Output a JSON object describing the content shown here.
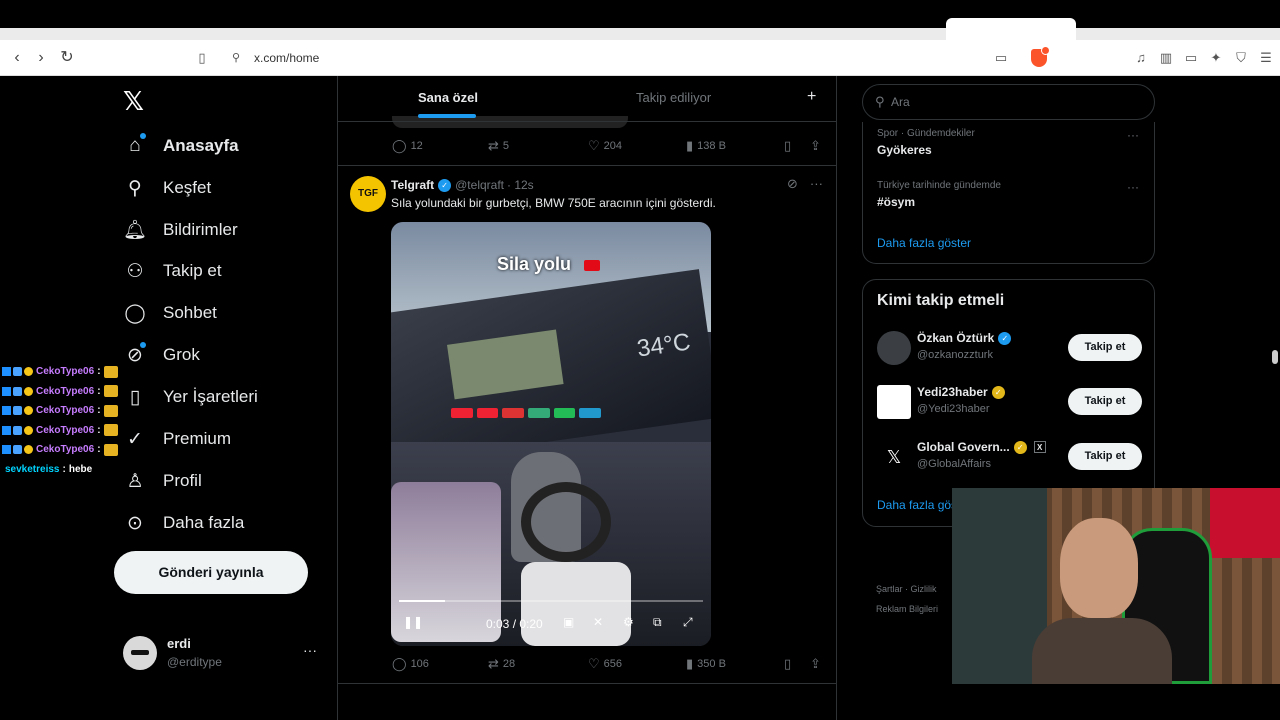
{
  "browser": {
    "url": "x.com/home"
  },
  "sidebar": {
    "items": [
      {
        "label": "Anasayfa"
      },
      {
        "label": "Keşfet"
      },
      {
        "label": "Bildirimler"
      },
      {
        "label": "Takip et"
      },
      {
        "label": "Sohbet"
      },
      {
        "label": "Grok"
      },
      {
        "label": "Yer İşaretleri"
      },
      {
        "label": "Premium"
      },
      {
        "label": "Profil"
      },
      {
        "label": "Daha fazla"
      }
    ],
    "post_button": "Gönderi yayınla",
    "profile": {
      "name": "erdi",
      "handle": "@erditype"
    }
  },
  "chat": {
    "user": "CekoType06",
    "user2": "sevketreiss",
    "msg2": "hebe"
  },
  "feed": {
    "tabs": [
      {
        "label": "Sana özel"
      },
      {
        "label": "Takip ediliyor"
      }
    ],
    "prev_actions": {
      "replies": "12",
      "reposts": "5",
      "likes": "204",
      "views": "138 B"
    },
    "tweet": {
      "name": "Telgraft",
      "handle": "@telqraft",
      "time": "· 12s",
      "text": "Sıla yolundaki bir gurbetçi, BMW 750E aracının içini gösterdi.",
      "video_title": "Sila yolu",
      "video_temp": "34°C",
      "video_time": "0:03 / 0:20",
      "video_progress": 0.15,
      "replies": "106",
      "reposts": "28",
      "likes": "656",
      "views": "350 B"
    }
  },
  "right": {
    "search_placeholder": "Ara",
    "trends": [
      {
        "category": "Spor · Gündemdekiler",
        "title": "Gyökeres"
      },
      {
        "category": "Türkiye tarihinde gündemde",
        "title": "#ösym"
      }
    ],
    "show_more": "Daha fazla göster",
    "follow_title": "Kimi takip etmeli",
    "follow": [
      {
        "name": "Özkan Öztürk",
        "handle": "@ozkanozzturk",
        "button": "Takip et"
      },
      {
        "name": "Yedi23haber",
        "handle": "@Yedi23haber",
        "button": "Takip et"
      },
      {
        "name": "Global Govern...",
        "handle": "@GlobalAffairs",
        "button": "Takip et"
      }
    ],
    "follow_more": "Daha fazla göster",
    "footer": {
      "l1": "Şartlar",
      "l2": "Gizlilik",
      "l3": "Reklam Bilgileri"
    }
  },
  "colors": {
    "accent": "#1d9bf0",
    "verified_gold": "#e2b719",
    "brave": "#fb542b"
  }
}
